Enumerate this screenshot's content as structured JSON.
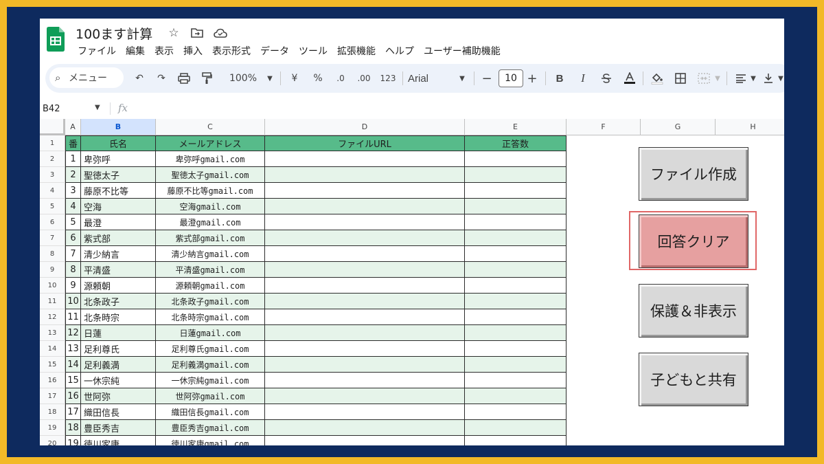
{
  "document": {
    "title": "100ます計算",
    "icons": [
      "star-icon",
      "move-folder-icon",
      "cloud-status-icon"
    ]
  },
  "menu": [
    "ファイル",
    "編集",
    "表示",
    "挿入",
    "表示形式",
    "データ",
    "ツール",
    "拡張機能",
    "ヘルプ",
    "ユーザー補助機能"
  ],
  "toolbar": {
    "search_label": "メニュー",
    "zoom": "100%",
    "currency": "¥",
    "percent": "%",
    "decrease_decimal": ".0",
    "increase_decimal": ".00",
    "number_format": "123",
    "font": "Arial",
    "font_size": "10",
    "minus": "−",
    "plus": "+",
    "bold": "B",
    "italic": "I"
  },
  "formula_bar": {
    "name_box": "B42",
    "fx": "fx"
  },
  "columns": [
    "A",
    "B",
    "C",
    "D",
    "E",
    "F",
    "G",
    "H"
  ],
  "header_row": {
    "row_number": "1",
    "no": "番",
    "name": "氏名",
    "email": "メールアドレス",
    "file_url": "ファイルURL",
    "score": "正答数"
  },
  "rows": [
    {
      "row": "2",
      "no": "1",
      "name": "卑弥呼",
      "email": "卑弥呼gmail.com"
    },
    {
      "row": "3",
      "no": "2",
      "name": "聖徳太子",
      "email": "聖徳太子gmail.com"
    },
    {
      "row": "4",
      "no": "3",
      "name": "藤原不比等",
      "email": "藤原不比等gmail.com"
    },
    {
      "row": "5",
      "no": "4",
      "name": "空海",
      "email": "空海gmail.com"
    },
    {
      "row": "6",
      "no": "5",
      "name": "最澄",
      "email": "最澄gmail.com"
    },
    {
      "row": "7",
      "no": "6",
      "name": "紫式部",
      "email": "紫式部gmail.com"
    },
    {
      "row": "8",
      "no": "7",
      "name": "清少納言",
      "email": "清少納言gmail.com"
    },
    {
      "row": "9",
      "no": "8",
      "name": "平清盛",
      "email": "平清盛gmail.com"
    },
    {
      "row": "10",
      "no": "9",
      "name": "源頼朝",
      "email": "源頼朝gmail.com"
    },
    {
      "row": "11",
      "no": "10",
      "name": "北条政子",
      "email": "北条政子gmail.com"
    },
    {
      "row": "12",
      "no": "11",
      "name": "北条時宗",
      "email": "北条時宗gmail.com"
    },
    {
      "row": "13",
      "no": "12",
      "name": "日蓮",
      "email": "日蓮gmail.com"
    },
    {
      "row": "14",
      "no": "13",
      "name": "足利尊氏",
      "email": "足利尊氏gmail.com"
    },
    {
      "row": "15",
      "no": "14",
      "name": "足利義満",
      "email": "足利義満gmail.com"
    },
    {
      "row": "16",
      "no": "15",
      "name": "一休宗純",
      "email": "一休宗純gmail.com"
    },
    {
      "row": "17",
      "no": "16",
      "name": "世阿弥",
      "email": "世阿弥gmail.com"
    },
    {
      "row": "18",
      "no": "17",
      "name": "織田信長",
      "email": "織田信長gmail.com"
    },
    {
      "row": "19",
      "no": "18",
      "name": "豊臣秀吉",
      "email": "豊臣秀吉gmail.com"
    },
    {
      "row": "20",
      "no": "19",
      "name": "徳川家康",
      "email": "徳川家康gmail.com"
    }
  ],
  "buttons": {
    "create_files": "ファイル作成",
    "clear_answers": "回答クリア",
    "protect_hide": "保護＆非表示",
    "share_children": "子どもと共有"
  },
  "colors": {
    "header_green": "#57bb8a",
    "row_band": "#e6f4ea",
    "button_gray": "#d9d9d9",
    "button_red": "#e6a0a0",
    "frame_navy": "#0e2a5e",
    "frame_yellow": "#f2b928"
  }
}
